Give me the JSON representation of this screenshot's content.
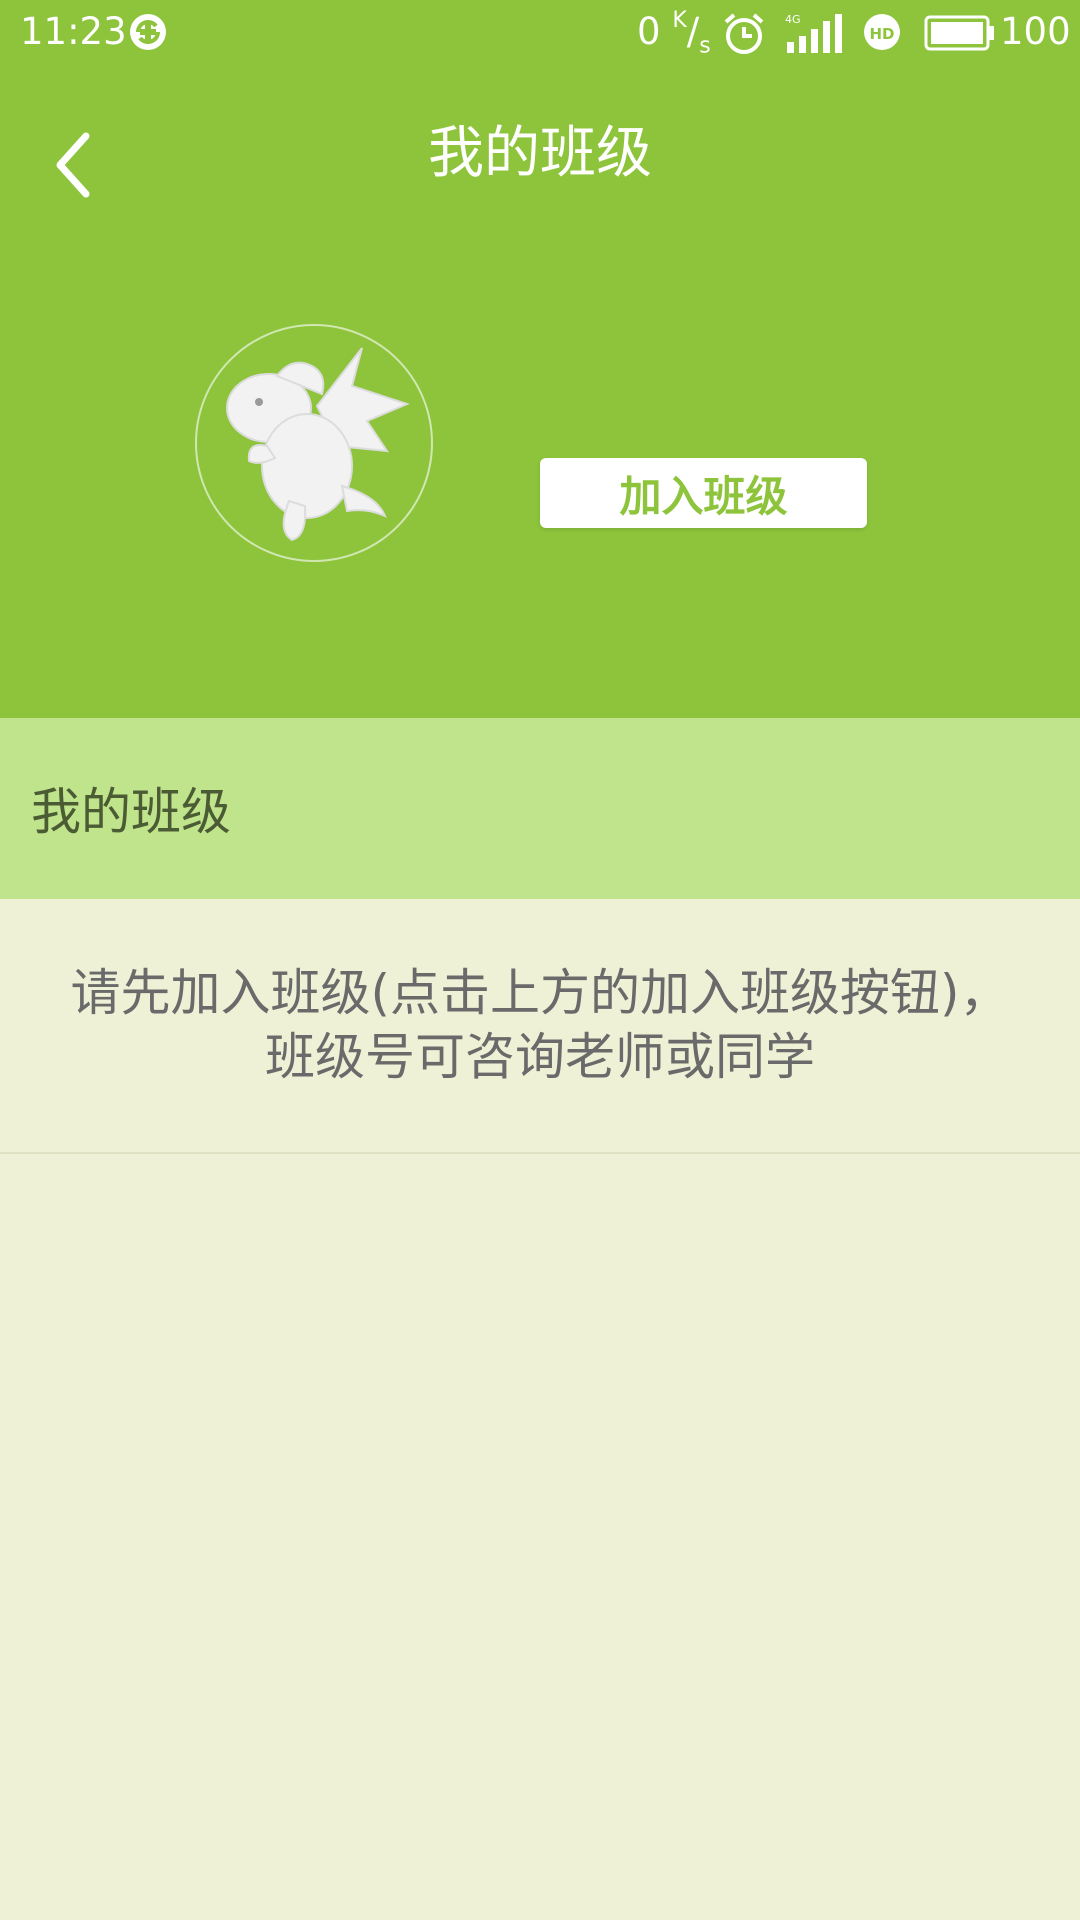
{
  "status_bar": {
    "time": "11:23",
    "net_speed_value": "0",
    "net_speed_unit_top": "K",
    "net_speed_unit_bottom": "s",
    "network": "4G",
    "battery_level": "100",
    "icons": [
      "sync-icon",
      "alarm-icon",
      "signal-icon",
      "hd-icon",
      "battery-icon"
    ]
  },
  "header": {
    "title": "我的班级",
    "back_icon": "chevron-left-icon",
    "avatar_icon": "dragon-icon",
    "join_button_label": "加入班级"
  },
  "section": {
    "title": "我的班级"
  },
  "empty_state": {
    "line1": "请先加入班级(点击上方的加入班级按钮)，",
    "line2": "班级号可咨询老师或同学"
  },
  "colors": {
    "primary_green": "#8dc43c",
    "section_header_bg": "#bfe48c",
    "page_bg": "#eef1d6"
  }
}
